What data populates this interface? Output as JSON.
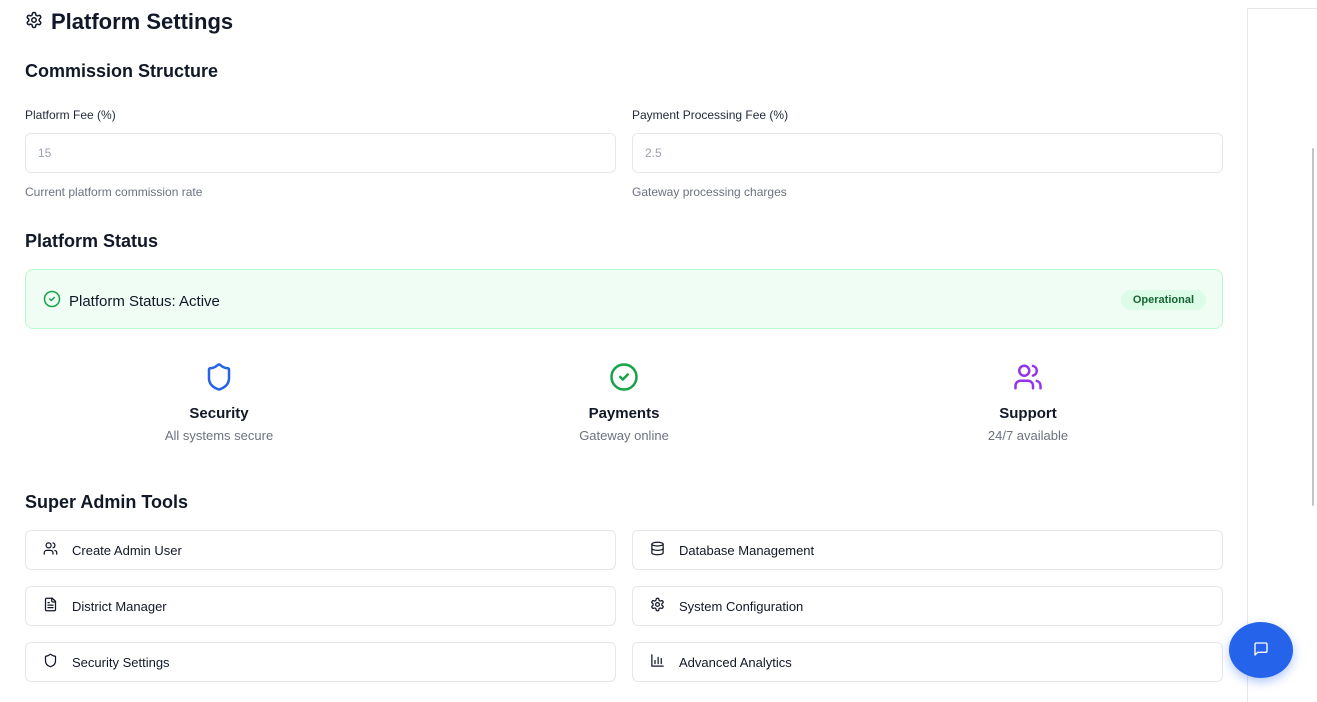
{
  "page": {
    "title": "Platform Settings",
    "title_icon": "gear-icon"
  },
  "commission": {
    "heading": "Commission Structure",
    "platform_fee": {
      "label": "Platform Fee (%)",
      "placeholder": "15",
      "value": "",
      "help": "Current platform commission rate"
    },
    "processing_fee": {
      "label": "Payment Processing Fee (%)",
      "placeholder": "2.5",
      "value": "",
      "help": "Gateway processing charges"
    }
  },
  "status": {
    "heading": "Platform Status",
    "message": "Platform Status: Active",
    "badge": "Operational",
    "colors": {
      "bg": "#f0fdf4",
      "border": "#bbf7d0",
      "icon": "#16a34a",
      "badge_bg": "#dcfce7",
      "badge_text": "#166534"
    },
    "cards": [
      {
        "icon": "shield-icon",
        "title": "Security",
        "subtitle": "All systems secure",
        "color": "#2563eb"
      },
      {
        "icon": "check-circle-icon",
        "title": "Payments",
        "subtitle": "Gateway online",
        "color": "#16a34a"
      },
      {
        "icon": "users-icon",
        "title": "Support",
        "subtitle": "24/7 available",
        "color": "#9333ea"
      }
    ]
  },
  "tools": {
    "heading": "Super Admin Tools",
    "items": [
      {
        "label": "Create Admin User",
        "icon": "users-icon"
      },
      {
        "label": "Database Management",
        "icon": "database-icon"
      },
      {
        "label": "District Manager",
        "icon": "file-text-icon"
      },
      {
        "label": "System Configuration",
        "icon": "gear-icon"
      },
      {
        "label": "Security Settings",
        "icon": "shield-icon"
      },
      {
        "label": "Advanced Analytics",
        "icon": "bar-chart-icon"
      }
    ]
  },
  "chat": {
    "icon": "chat-icon",
    "color": "#2563eb"
  }
}
